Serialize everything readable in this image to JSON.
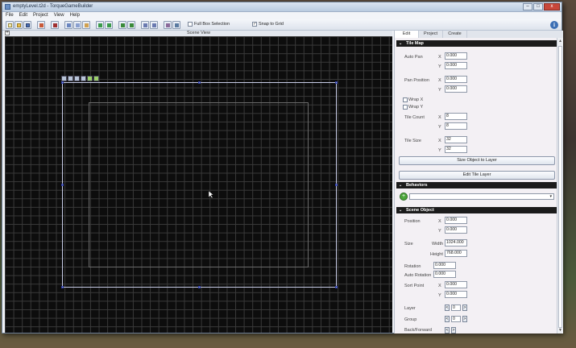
{
  "window": {
    "title": "emptyLevel.t2d - TorqueGameBuilder",
    "controls": [
      "–",
      "□",
      "x"
    ]
  },
  "menu": [
    "File",
    "Edit",
    "Project",
    "View",
    "Help"
  ],
  "toolbar": {
    "full_box_selection": "Full Box Selection",
    "snap_to_grid": "Snap to Grid",
    "snap_checked": "✓",
    "info_icon": "i"
  },
  "scene": {
    "header": "Scene View",
    "expand": "+"
  },
  "inspector": {
    "tabs": [
      "Edit",
      "Project",
      "Create"
    ],
    "chevron": "⌄",
    "tile_map": {
      "header": "Tile Map",
      "auto_pan": "Auto Pan",
      "auto_pan_x": "0.000",
      "auto_pan_y": "0.000",
      "pan_position": "Pan Position",
      "pan_x": "0.000",
      "pan_y": "0.000",
      "wrap_x": "Wrap X",
      "wrap_y": "Wrap Y",
      "tile_count": "Tile Count",
      "tile_count_x": "8",
      "tile_count_y": "8",
      "tile_size": "Tile Size",
      "tile_size_x": "32",
      "tile_size_y": "32",
      "size_object_btn": "Size Object to Layer",
      "edit_tile_btn": "Edit Tile Layer"
    },
    "behaviors": {
      "header": "Behaviors",
      "add": "+",
      "dropdown_arrow": "▾"
    },
    "scene_object": {
      "header": "Scene Object",
      "position": "Position",
      "pos_x": "0.000",
      "pos_y": "0.000",
      "size": "Size",
      "width_label": "Width",
      "width": "1024.000",
      "height_label": "Height",
      "height": "768.000",
      "rotation": "Rotation",
      "rotation_val": "0.000",
      "auto_rotation": "Auto Rotation",
      "auto_rotation_val": "0.000",
      "sort_point": "Sort Point",
      "sort_x": "0.000",
      "sort_y": "0.000",
      "layer": "Layer",
      "layer_val": "0",
      "group": "Group",
      "group_val": "0",
      "back_forward": "Back/Forward",
      "spin_left": "<",
      "spin_right": ">"
    },
    "axis_x": "X",
    "axis_y": "Y"
  }
}
